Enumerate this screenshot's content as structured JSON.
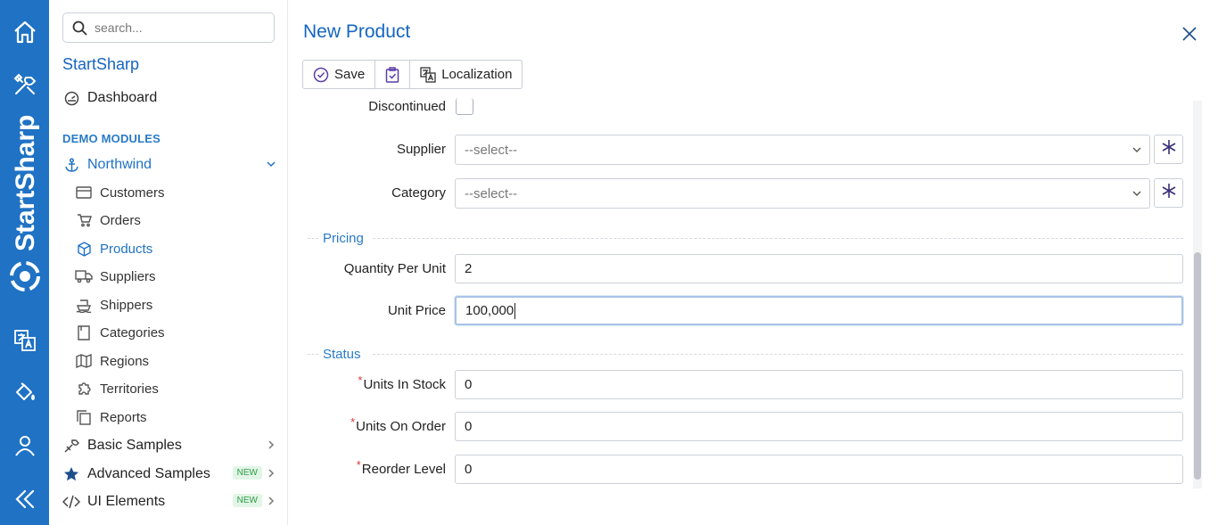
{
  "rail": {
    "brand_text": "StartSharp",
    "icons": [
      "home-icon",
      "tools-icon",
      "translate-icon",
      "paint-bucket-icon",
      "user-icon",
      "collapse-icon"
    ]
  },
  "sidebar": {
    "search_placeholder": "search...",
    "app_title": "StartSharp",
    "dashboard": "Dashboard",
    "section_label": "DEMO MODULES",
    "northwind": "Northwind",
    "items": [
      {
        "label": "Customers",
        "icon": "card-icon"
      },
      {
        "label": "Orders",
        "icon": "cart-icon"
      },
      {
        "label": "Products",
        "icon": "box-icon"
      },
      {
        "label": "Suppliers",
        "icon": "truck-icon"
      },
      {
        "label": "Shippers",
        "icon": "ship-icon"
      },
      {
        "label": "Categories",
        "icon": "bookmark-icon"
      },
      {
        "label": "Regions",
        "icon": "map-icon"
      },
      {
        "label": "Territories",
        "icon": "puzzle-icon"
      },
      {
        "label": "Reports",
        "icon": "copy-icon"
      }
    ],
    "basic_samples": "Basic Samples",
    "advanced_samples": "Advanced Samples",
    "advanced_badge": "NEW",
    "ui_elements": "UI Elements",
    "ui_badge": "NEW"
  },
  "dialog": {
    "title": "New Product",
    "toolbar": {
      "save": "Save",
      "localization": "Localization"
    },
    "form": {
      "discontinued_label": "Discontinued",
      "supplier_label": "Supplier",
      "supplier_value": "--select--",
      "category_label": "Category",
      "category_value": "--select--",
      "pricing_title": "Pricing",
      "qpu_label": "Quantity Per Unit",
      "qpu_value": "2",
      "unit_price_label": "Unit Price",
      "unit_price_value": "100,000",
      "status_title": "Status",
      "required_mark": "*",
      "units_in_stock_label": "Units In Stock",
      "units_in_stock_value": "0",
      "units_on_order_label": "Units On Order",
      "units_on_order_value": "0",
      "reorder_level_label": "Reorder Level",
      "reorder_level_value": "0"
    }
  },
  "colors": {
    "rail": "#1f72c4",
    "accent": "#1565c0",
    "required": "#d9383a",
    "badge": "#2e9d47"
  }
}
